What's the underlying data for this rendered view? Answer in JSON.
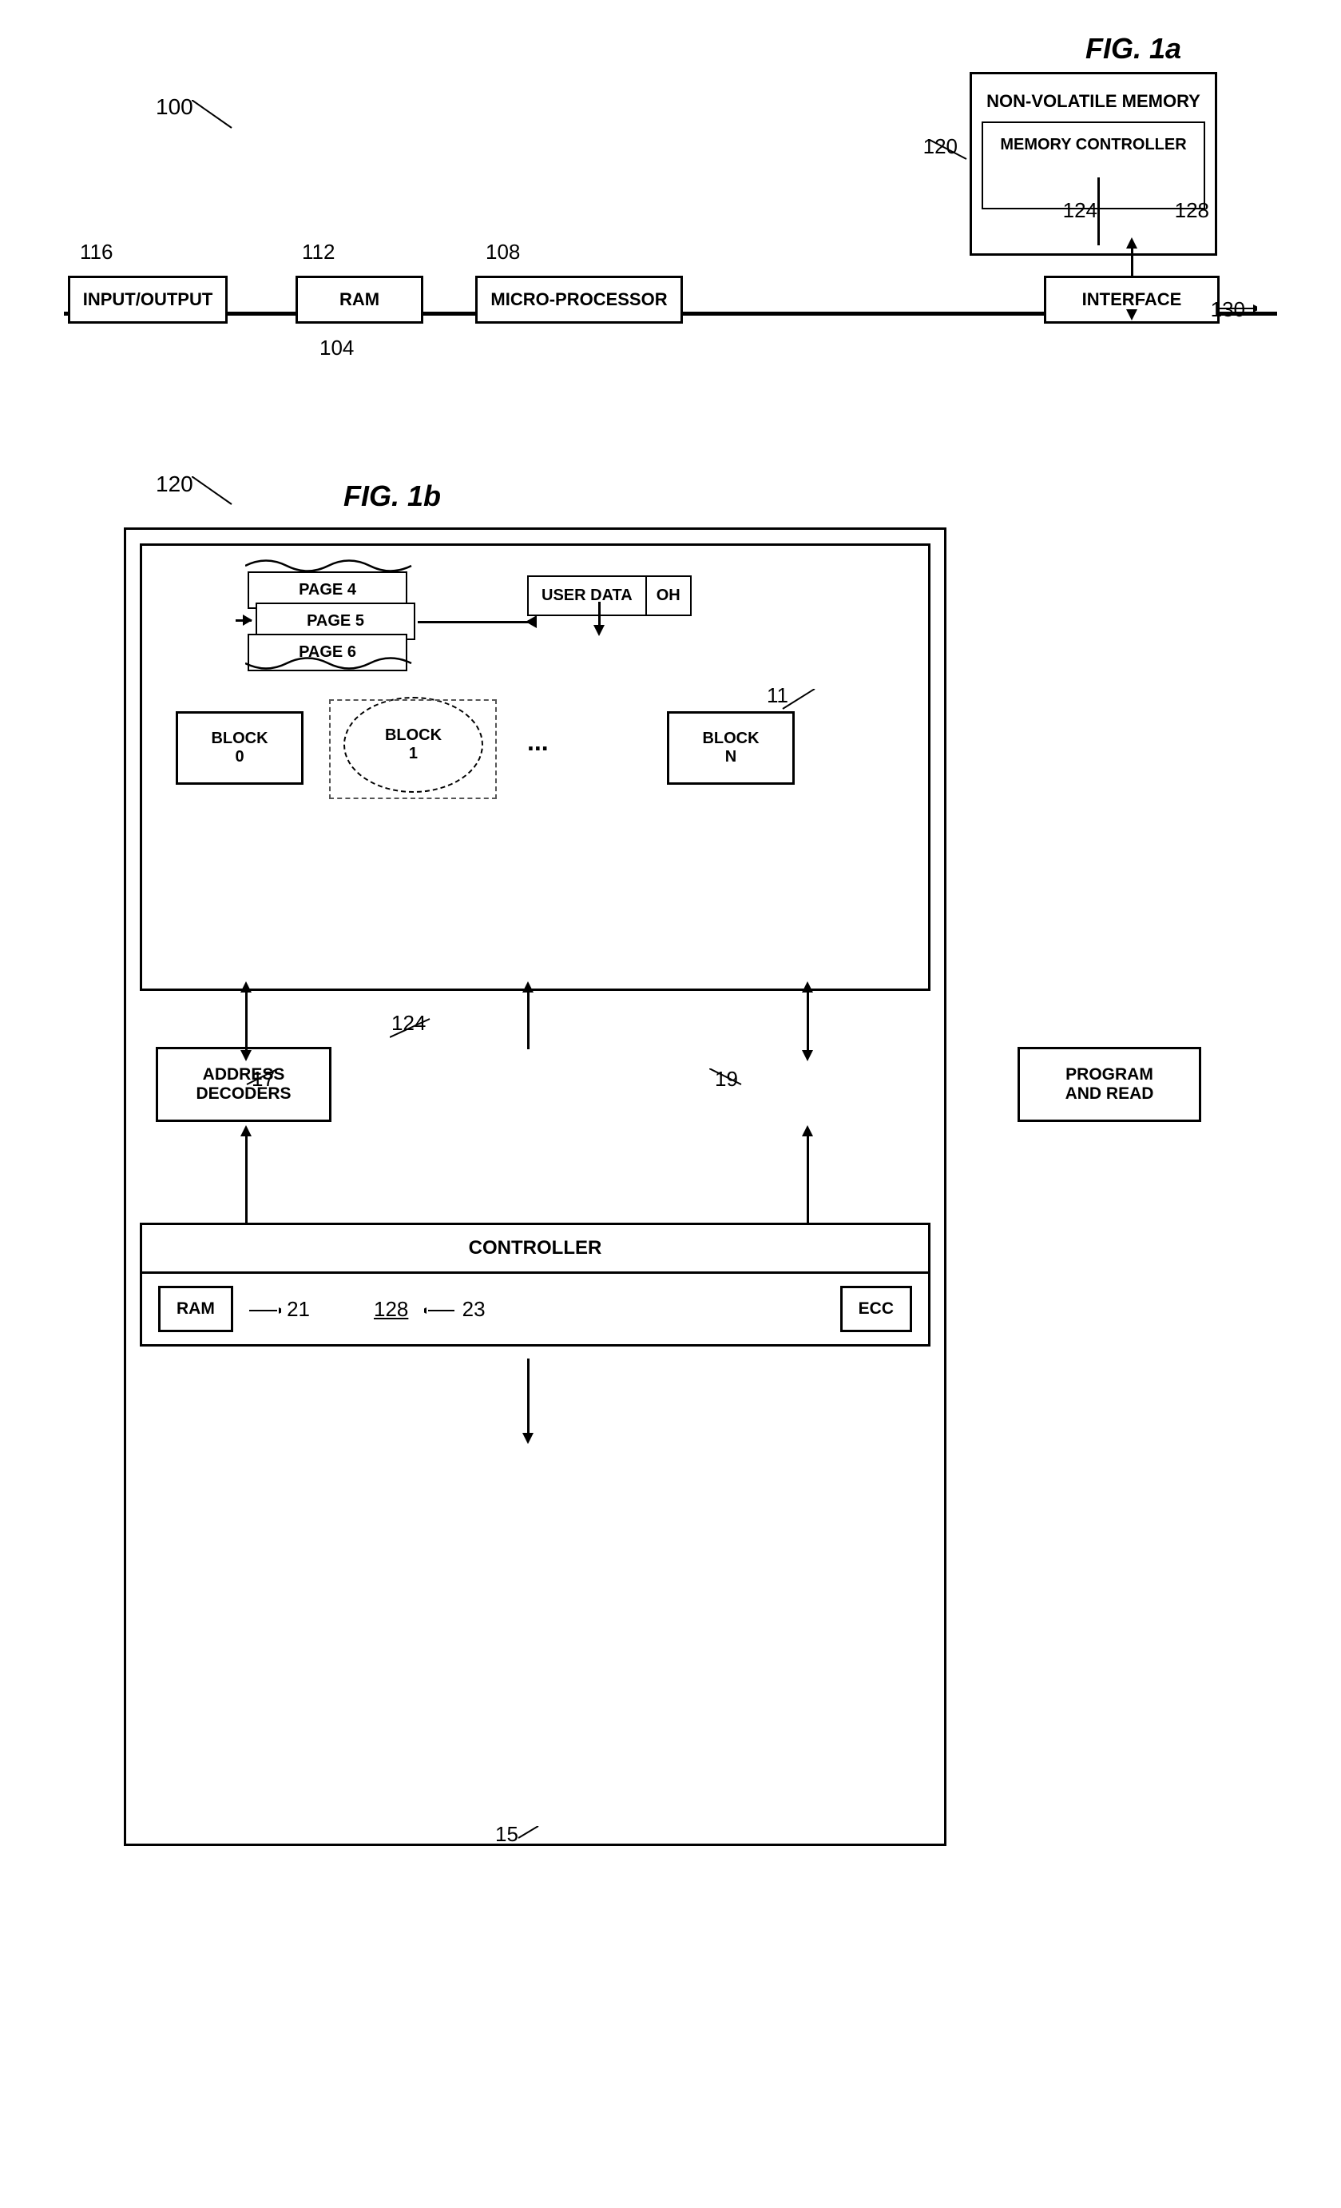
{
  "fig1a": {
    "title": "FIG. 1a",
    "label_100": "100",
    "label_120": "120",
    "label_124": "124",
    "label_128": "128",
    "label_130": "130",
    "label_104": "104",
    "label_116": "116",
    "label_112": "112",
    "label_108": "108",
    "nvm_label": "NON-VOLATILE MEMORY",
    "mem_ctrl_label": "MEMORY CONTROLLER",
    "io_label": "INPUT/OUTPUT",
    "ram_label": "RAM",
    "micro_label": "MICRO-PROCESSOR",
    "interface_label": "INTERFACE"
  },
  "fig1b": {
    "title": "FIG. 1b",
    "label_120": "120",
    "label_11": "11",
    "label_17": "17",
    "label_19": "19",
    "label_21": "21",
    "label_23": "23",
    "label_124": "124",
    "label_128": "128",
    "label_15": "15",
    "page4_label": "PAGE 4",
    "page5_label": "PAGE 5",
    "page6_label": "PAGE 6",
    "user_data_label": "USER DATA",
    "oh_label": "OH",
    "block0_label": "BLOCK\n0",
    "block1_label": "BLOCK\n1",
    "block_dots": "...",
    "blockn_label": "BLOCK\nN",
    "addr_dec_label": "ADDRESS\nDECODERS",
    "prog_read_label": "PROGRAM\nAND READ",
    "controller_label": "CONTROLLER",
    "ram_ctrl_label": "RAM",
    "ecc_label": "ECC"
  }
}
